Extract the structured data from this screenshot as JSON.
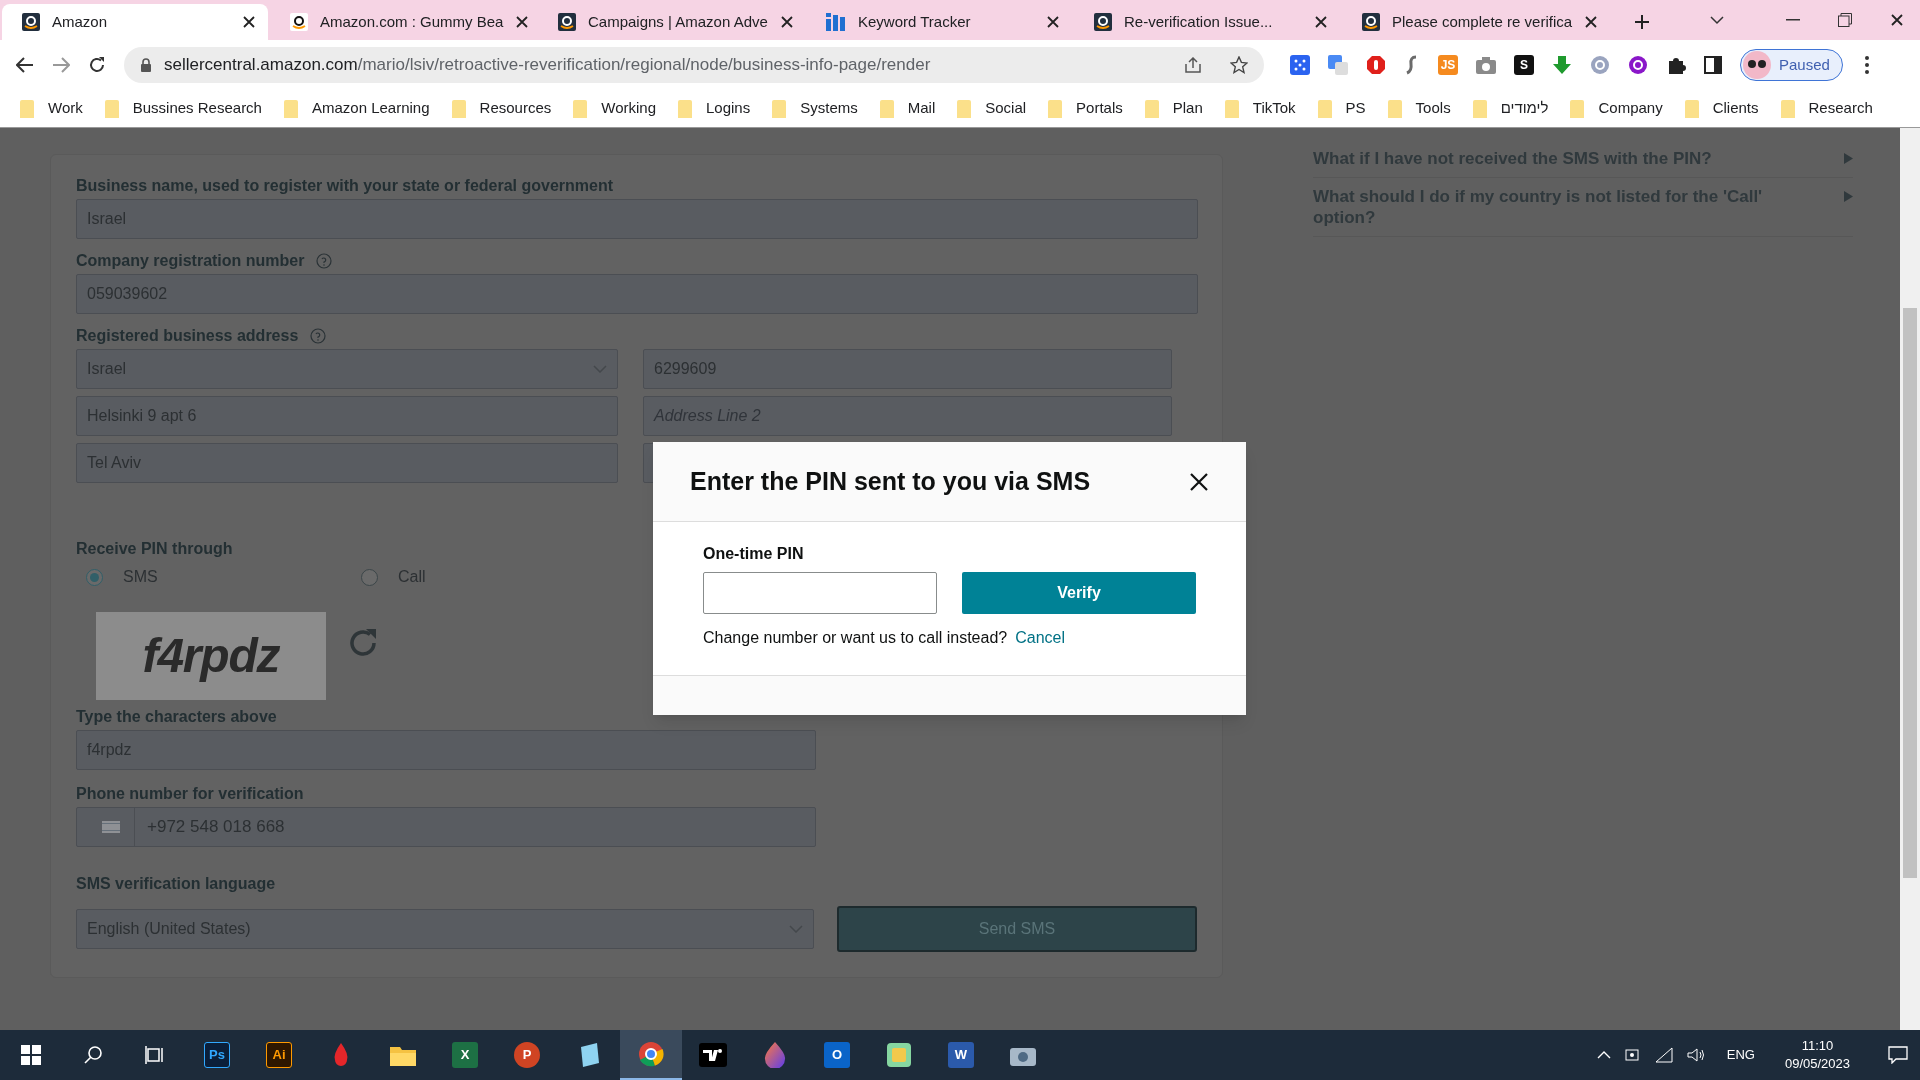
{
  "tabs": [
    {
      "title": "Amazon",
      "kind": "amazon",
      "selected": true
    },
    {
      "title": "Amazon.com : Gummy Bea",
      "kind": "amazon-light",
      "selected": false
    },
    {
      "title": "Campaigns | Amazon Adve",
      "kind": "amazon",
      "selected": false
    },
    {
      "title": "Keyword Tracker",
      "kind": "bars",
      "selected": false
    },
    {
      "title": "Re-verification Issue...",
      "kind": "amazon",
      "selected": false
    },
    {
      "title": "Please complete re verifica",
      "kind": "amazon",
      "selected": false
    }
  ],
  "address_bar": {
    "domain": "sellercentral.amazon.com",
    "path": "/mario/lsiv/retroactive-reverification/regional/node/business-info-page/render"
  },
  "extensions": [
    {
      "kind": "dots",
      "color": "#2b63f0"
    },
    {
      "kind": "translate",
      "color": "#4a8af4"
    },
    {
      "kind": "stop",
      "color": "#e0201b"
    },
    {
      "kind": "script",
      "color": "#6b6b6b"
    },
    {
      "kind": "text",
      "label": "JS",
      "color": "#f58a1f"
    },
    {
      "kind": "camera",
      "color": "#8a8a8a"
    },
    {
      "kind": "text",
      "label": "S",
      "color": "#111111"
    },
    {
      "kind": "download",
      "color": "#1f9a2e"
    },
    {
      "kind": "circle",
      "color": "#9aa4bf"
    },
    {
      "kind": "circle",
      "color": "#8a17c9"
    },
    {
      "kind": "puzzle",
      "color": "#222222"
    },
    {
      "kind": "panel",
      "color": "#222222"
    }
  ],
  "profile": {
    "label": "Paused"
  },
  "bookmarks": [
    "Work",
    "Bussines Research",
    "Amazon Learning",
    "Resources",
    "Working",
    "Logins",
    "Systems",
    "Mail",
    "Social",
    "Portals",
    "Plan",
    "TikTok",
    "PS",
    "Tools",
    "לימודים",
    "Company",
    "Clients",
    "Research"
  ],
  "form": {
    "business_name": {
      "label": "Business name, used to register with your state or federal government",
      "value": "Israel"
    },
    "registration_number": {
      "label": "Company registration number",
      "value": "059039602"
    },
    "address": {
      "label": "Registered business address",
      "country": "Israel",
      "postal_code": "6299609",
      "line1": "Helsinki 9 apt 6",
      "line2_placeholder": "Address Line 2",
      "city": "Tel Aviv"
    },
    "receive_pin": {
      "label": "Receive PIN through",
      "options": [
        {
          "label": "SMS",
          "selected": true
        },
        {
          "label": "Call",
          "selected": false
        }
      ]
    },
    "captcha": {
      "text": "f4rpdz"
    },
    "characters": {
      "label": "Type the characters above",
      "value": "f4rpdz"
    },
    "phone": {
      "label": "Phone number for verification",
      "value": "+972 548 018 668"
    },
    "language": {
      "label": "SMS verification language",
      "value": "English (United States)"
    },
    "send_button": "Send SMS"
  },
  "faq": [
    "What if I have not received the SMS with the PIN?",
    "What should I do if my country is not listed for the 'Call' option?"
  ],
  "modal": {
    "title": "Enter the PIN sent to you via SMS",
    "pin_label": "One-time PIN",
    "verify_button": "Verify",
    "prompt": "Change number or want us to call instead?",
    "cancel_link": "Cancel"
  },
  "taskbar": {
    "apps": [
      {
        "kind": "ps",
        "label": "Ps",
        "active": false
      },
      {
        "kind": "ai",
        "label": "Ai",
        "active": false
      },
      {
        "kind": "flame",
        "active": false
      },
      {
        "kind": "folder",
        "active": false
      },
      {
        "kind": "excel",
        "label": "X",
        "active": false
      },
      {
        "kind": "powerpoint",
        "label": "P",
        "active": false
      },
      {
        "kind": "notepad",
        "active": false
      },
      {
        "kind": "chrome",
        "active": true
      },
      {
        "kind": "tv",
        "active": false
      },
      {
        "kind": "drop",
        "active": false
      },
      {
        "kind": "outlook",
        "label": "O",
        "active": false
      },
      {
        "kind": "tile",
        "active": false
      },
      {
        "kind": "word",
        "label": "W",
        "active": false
      },
      {
        "kind": "camera",
        "active": false
      }
    ],
    "language": "ENG",
    "time": "11:10",
    "date": "09/05/2023"
  }
}
